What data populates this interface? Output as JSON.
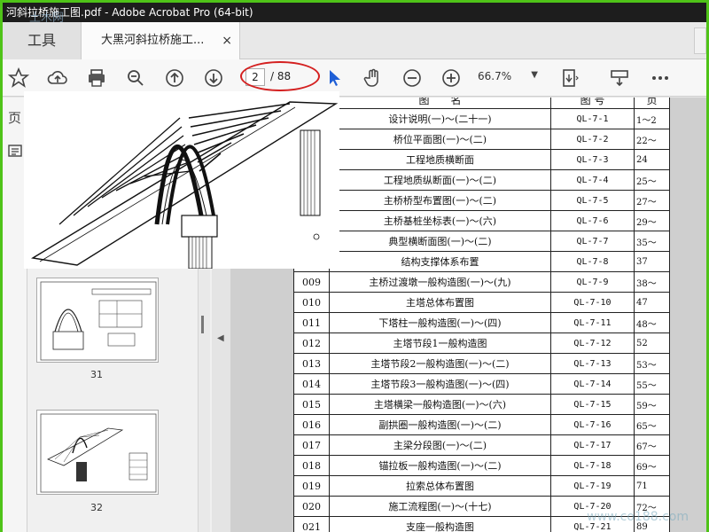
{
  "window": {
    "title": "河斜拉桥施工图.pdf - Adobe Acrobat Pro (64-bit)"
  },
  "tabs": {
    "tools_label": "工具",
    "doc_label": "大黑河斜拉桥施工...",
    "close": "×"
  },
  "toolbar": {
    "page_current": "2",
    "page_total": "/ 88",
    "zoom": "66.7%",
    "icons": [
      "star-icon",
      "cloud-upload-icon",
      "print-icon",
      "zoom-search-icon",
      "page-up-icon",
      "page-down-icon",
      "select-cursor-icon",
      "hand-icon",
      "zoom-out-icon",
      "zoom-in-icon",
      "page-view-icon",
      "comment-icon",
      "more-icon"
    ]
  },
  "leftrail": {
    "label": "页"
  },
  "thumbnails": [
    {
      "label": "31"
    },
    {
      "label": "32"
    }
  ],
  "index_table": {
    "header": {
      "name": "图　　名",
      "code": "图 号",
      "pages": "页"
    },
    "rows": [
      {
        "no": "",
        "name": "设计说明(一)～(二十一)",
        "code": "QL-7-1",
        "pages": "1～2"
      },
      {
        "no": "",
        "name": "桥位平面图(一)～(二)",
        "code": "QL-7-2",
        "pages": "22～"
      },
      {
        "no": "",
        "name": "工程地质横断面",
        "code": "QL-7-3",
        "pages": "24"
      },
      {
        "no": "",
        "name": "工程地质纵断面(一)～(二)",
        "code": "QL-7-4",
        "pages": "25～"
      },
      {
        "no": "",
        "name": "主桥桥型布置图(一)～(二)",
        "code": "QL-7-5",
        "pages": "27～"
      },
      {
        "no": "",
        "name": "主桥基桩坐标表(一)～(六)",
        "code": "QL-7-6",
        "pages": "29～"
      },
      {
        "no": "",
        "name": "典型横断面图(一)～(二)",
        "code": "QL-7-7",
        "pages": "35～"
      },
      {
        "no": "",
        "name": "结构支撑体系布置",
        "code": "QL-7-8",
        "pages": "37"
      },
      {
        "no": "009",
        "name": "主桥过渡墩一般构造图(一)～(九)",
        "code": "QL-7-9",
        "pages": "38～"
      },
      {
        "no": "010",
        "name": "主塔总体布置图",
        "code": "QL-7-10",
        "pages": "47"
      },
      {
        "no": "011",
        "name": "下塔柱一般构造图(一)～(四)",
        "code": "QL-7-11",
        "pages": "48～"
      },
      {
        "no": "012",
        "name": "主塔节段1一般构造图",
        "code": "QL-7-12",
        "pages": "52"
      },
      {
        "no": "013",
        "name": "主塔节段2一般构造图(一)～(二)",
        "code": "QL-7-13",
        "pages": "53～"
      },
      {
        "no": "014",
        "name": "主塔节段3一般构造图(一)～(四)",
        "code": "QL-7-14",
        "pages": "55～"
      },
      {
        "no": "015",
        "name": "主塔横梁一般构造图(一)～(六)",
        "code": "QL-7-15",
        "pages": "59～"
      },
      {
        "no": "016",
        "name": "副拱圈一般构造图(一)～(二)",
        "code": "QL-7-16",
        "pages": "65～"
      },
      {
        "no": "017",
        "name": "主梁分段图(一)～(二)",
        "code": "QL-7-17",
        "pages": "67～"
      },
      {
        "no": "018",
        "name": "锚拉板一般构造图(一)～(二)",
        "code": "QL-7-18",
        "pages": "69～"
      },
      {
        "no": "019",
        "name": "拉索总体布置图",
        "code": "QL-7-19",
        "pages": "71"
      },
      {
        "no": "020",
        "name": "施工流程图(一)～(十七)",
        "code": "QL-7-20",
        "pages": "72～"
      },
      {
        "no": "021",
        "name": "支座一般构造图",
        "code": "QL-7-21",
        "pages": "89"
      }
    ]
  },
  "watermarks": {
    "top_left": "土木网",
    "bottom_right": "www.co188.com"
  },
  "colors": {
    "frame": "#4fc318",
    "titlebar": "#1d1d1d",
    "annotation": "#d42020",
    "cursor": "#1f5fd6"
  }
}
